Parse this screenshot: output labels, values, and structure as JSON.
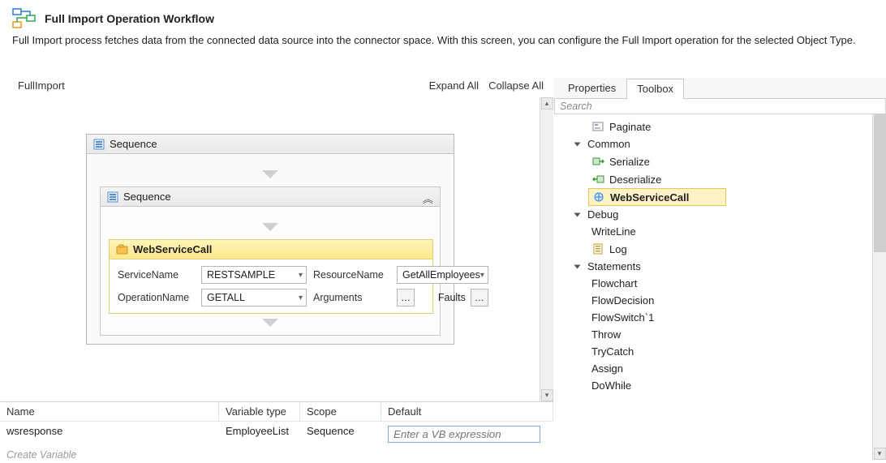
{
  "header": {
    "title": "Full Import Operation Workflow",
    "subtitle": "Full Import process fetches data from the connected data source into the connector space. With this screen, you can configure the Full Import operation for the selected Object Type."
  },
  "designer": {
    "breadcrumb": "FullImport",
    "expand_all": "Expand All",
    "collapse_all": "Collapse All",
    "outer_sequence_title": "Sequence",
    "inner_sequence_title": "Sequence",
    "ws_call": {
      "title": "WebServiceCall",
      "service_label": "ServiceName",
      "service_value": "RESTSAMPLE",
      "resource_label": "ResourceName",
      "resource_value": "GetAllEmployees",
      "operation_label": "OperationName",
      "operation_value": "GETALL",
      "arguments_label": "Arguments",
      "faults_label": "Faults"
    }
  },
  "variables": {
    "columns": {
      "name": "Name",
      "type": "Variable type",
      "scope": "Scope",
      "default": "Default"
    },
    "rows": [
      {
        "name": "wsresponse",
        "type": "EmployeeList",
        "scope": "Sequence"
      }
    ],
    "default_placeholder": "Enter a VB expression",
    "create_label": "Create Variable"
  },
  "right_panel": {
    "tabs": {
      "properties": "Properties",
      "toolbox": "Toolbox"
    },
    "search_placeholder": "Search",
    "items": {
      "paginate": "Paginate",
      "cat_common": "Common",
      "serialize": "Serialize",
      "deserialize": "Deserialize",
      "webservicecall": "WebServiceCall",
      "cat_debug": "Debug",
      "writeline": "WriteLine",
      "log": "Log",
      "cat_statements": "Statements",
      "flowchart": "Flowchart",
      "flowdecision": "FlowDecision",
      "flowswitch": "FlowSwitch`1",
      "throw": "Throw",
      "trycatch": "TryCatch",
      "assign": "Assign",
      "dowhile": "DoWhile"
    }
  }
}
